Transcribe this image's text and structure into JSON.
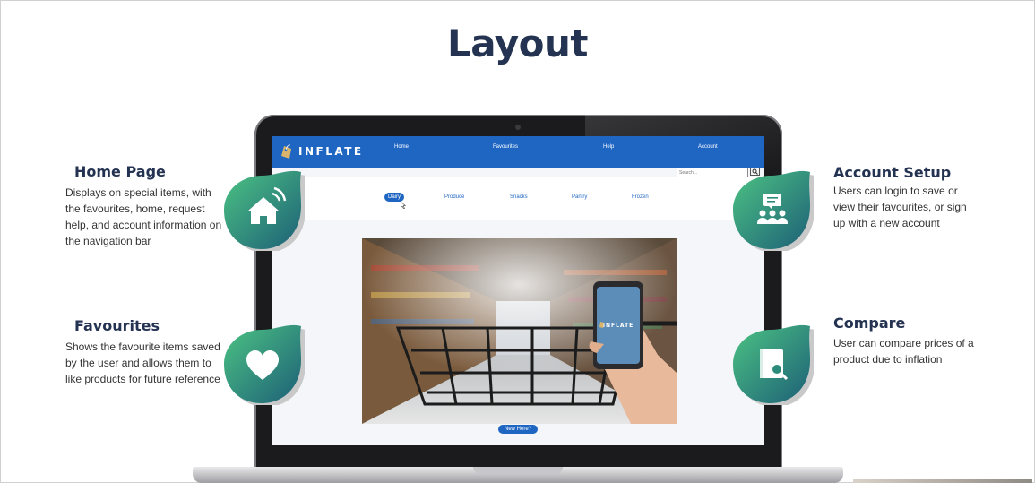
{
  "slide": {
    "title": "Layout"
  },
  "site": {
    "logo_text": "INFLATE",
    "nav": [
      "Home",
      "Favourites",
      "Help",
      "Account"
    ],
    "search_placeholder": "Search...",
    "categories": [
      "Dairy",
      "Produce",
      "Snacks",
      "Pantry",
      "Frozen"
    ],
    "active_category": "Dairy",
    "cta_label": "New Here?",
    "phone_logo": "INFLATE",
    "colors": {
      "primary": "#1f66c3",
      "logo_gold": "#d9b46a",
      "phone_screen": "#5b8db8"
    }
  },
  "features": {
    "home": {
      "title": "Home Page",
      "description": "Displays on special items, with the favourites, home, request help, and account information on the navigation bar",
      "icon": "house-icon"
    },
    "favourites": {
      "title": "Favourites",
      "description": "Shows the favourite items saved by the user and allows them to like products for future reference",
      "icon": "heart-icon"
    },
    "account": {
      "title": "Account Setup",
      "description": "Users can login to save or view their favourites, or sign up with a new account",
      "icon": "users-chat-icon"
    },
    "compare": {
      "title": "Compare",
      "description": "User can compare prices of a product due to inflation",
      "icon": "book-search-icon"
    },
    "colors": {
      "blob_green": "#3fb67a",
      "blob_teal": "#1f6b7a",
      "title": "#243352"
    }
  }
}
